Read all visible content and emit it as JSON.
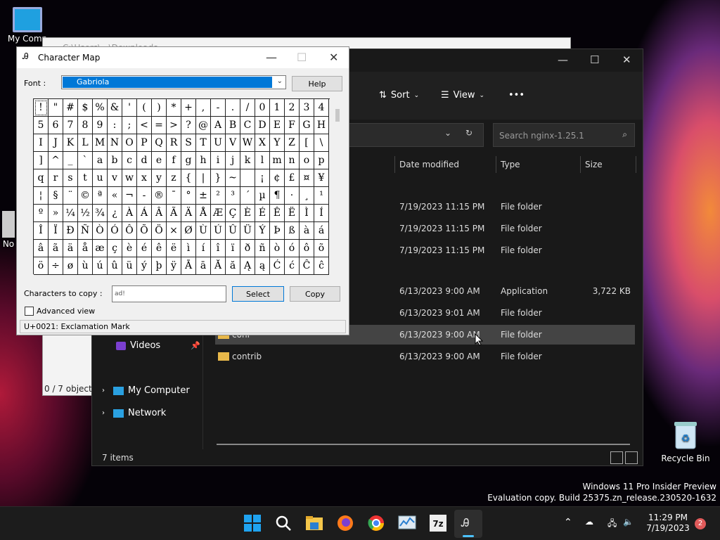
{
  "desktop": {
    "icons": [
      {
        "label": "My Comp",
        "name": "my-computer"
      },
      {
        "label": "Recycle Bin",
        "name": "recycle-bin"
      },
      {
        "label": "No",
        "name": "notepad"
      }
    ],
    "watermark_line1": "Windows 11 Pro Insider Preview",
    "watermark_line2": "Evaluation copy. Build 25375.zn_release.230520-1632"
  },
  "backwin": {
    "title": "C:\\Users\\...\\Downloads",
    "status": "0 / 7 object(s"
  },
  "explorer": {
    "toolbar": {
      "sort": "Sort",
      "view": "View",
      "more": "•••"
    },
    "search_placeholder": "Search nginx-1.25.1",
    "columns": {
      "date": "Date modified",
      "type": "Type",
      "size": "Size"
    },
    "rows": [
      {
        "name": "",
        "date": "7/19/2023 11:15 PM",
        "type": "File folder",
        "size": ""
      },
      {
        "name": "",
        "date": "7/19/2023 11:15 PM",
        "type": "File folder",
        "size": ""
      },
      {
        "name": "",
        "date": "7/19/2023 11:15 PM",
        "type": "File folder",
        "size": ""
      },
      {
        "name": "",
        "date": "6/13/2023 9:00 AM",
        "type": "Application",
        "size": "3,722 KB"
      },
      {
        "name": "",
        "date": "6/13/2023 9:01 AM",
        "type": "File folder",
        "size": ""
      },
      {
        "name": "conf",
        "date": "6/13/2023 9:00 AM",
        "type": "File folder",
        "size": ""
      },
      {
        "name": "contrib",
        "date": "6/13/2023 9:00 AM",
        "type": "File folder",
        "size": ""
      }
    ],
    "nav": {
      "videos": "Videos",
      "my_computer": "My Computer",
      "network": "Network"
    },
    "status": "7 items"
  },
  "charmap": {
    "title": "Character Map",
    "font_label": "Font :",
    "font_value": "Gabriola",
    "help_label": "Help",
    "chars": [
      "!",
      "\"",
      "#",
      "$",
      "%",
      "&",
      "'",
      "(",
      ")",
      "*",
      "+",
      ",",
      "-",
      ".",
      "/",
      "0",
      "1",
      "2",
      "3",
      "4",
      "5",
      "6",
      "7",
      "8",
      "9",
      ":",
      ";",
      "<",
      "=",
      ">",
      "?",
      "@",
      "A",
      "B",
      "C",
      "D",
      "E",
      "F",
      "G",
      "H",
      "I",
      "J",
      "K",
      "L",
      "M",
      "N",
      "O",
      "P",
      "Q",
      "R",
      "S",
      "T",
      "U",
      "V",
      "W",
      "X",
      "Y",
      "Z",
      "[",
      "\\",
      "]",
      "^",
      "_",
      "`",
      "a",
      "b",
      "c",
      "d",
      "e",
      "f",
      "g",
      "h",
      "i",
      "j",
      "k",
      "l",
      "m",
      "n",
      "o",
      "p",
      "q",
      "r",
      "s",
      "t",
      "u",
      "v",
      "w",
      "x",
      "y",
      "z",
      "{",
      "|",
      "}",
      "~",
      " ",
      "¡",
      "¢",
      "£",
      "¤",
      "¥",
      "¦",
      "§",
      "¨",
      "©",
      "ª",
      "«",
      "¬",
      "-",
      "®",
      "¯",
      "°",
      "±",
      "²",
      "³",
      "´",
      "µ",
      "¶",
      "·",
      "¸",
      "¹",
      "º",
      "»",
      "¼",
      "½",
      "¾",
      "¿",
      "À",
      "Á",
      "Â",
      "Ã",
      "Ä",
      "Å",
      "Æ",
      "Ç",
      "È",
      "É",
      "Ê",
      "Ë",
      "Ì",
      "Í",
      "Î",
      "Ï",
      "Ð",
      "Ñ",
      "Ò",
      "Ó",
      "Ô",
      "Õ",
      "Ö",
      "×",
      "Ø",
      "Ù",
      "Ú",
      "Û",
      "Ü",
      "Ý",
      "Þ",
      "ß",
      "à",
      "á",
      "â",
      "ã",
      "ä",
      "å",
      "æ",
      "ç",
      "è",
      "é",
      "ê",
      "ë",
      "ì",
      "í",
      "î",
      "ï",
      "ð",
      "ñ",
      "ò",
      "ó",
      "ô",
      "õ",
      "ö",
      "÷",
      "ø",
      "ù",
      "ú",
      "û",
      "ü",
      "ý",
      "þ",
      "ÿ",
      "Ā",
      "ā",
      "Ă",
      "ă",
      "Ą",
      "ą",
      "Ć",
      "ć",
      "Ĉ",
      "ĉ"
    ],
    "copy_label": "Characters to copy :",
    "copy_value": "ad!",
    "select_label": "Select",
    "copy_button": "Copy",
    "advanced_label": "Advanced view",
    "status": "U+0021: Exclamation Mark"
  },
  "taskbar": {
    "time": "11:29 PM",
    "date": "7/19/2023",
    "notif_count": "2"
  }
}
